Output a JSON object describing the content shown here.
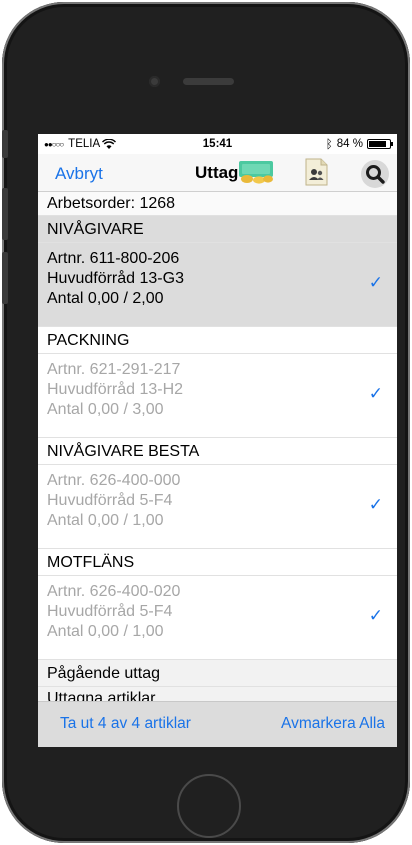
{
  "status": {
    "carrier": "TELIA",
    "time": "15:41",
    "battery": "84 %",
    "battery_level": 0.84
  },
  "navbar": {
    "cancel_label": "Avbryt",
    "title": "Uttag"
  },
  "order": {
    "label": "Arbetsorder: 1268"
  },
  "groups": [
    {
      "name": "NIVÅGIVARE",
      "artnr": "Artnr. 611-800-206",
      "location": "Huvudförråd 13-G3",
      "quantity": "Antal 0,00 / 2,00",
      "checked": "✓"
    },
    {
      "name": "PACKNING",
      "artnr": "Artnr. 621-291-217",
      "location": "Huvudförråd 13-H2",
      "quantity": "Antal 0,00 / 3,00",
      "checked": "✓"
    },
    {
      "name": "NIVÅGIVARE BESTA",
      "artnr": "Artnr. 626-400-000",
      "location": "Huvudförråd 5-F4",
      "quantity": "Antal 0,00 / 1,00",
      "checked": "✓"
    },
    {
      "name": "MOTFLÄNS",
      "artnr": "Artnr. 626-400-020",
      "location": "Huvudförråd 5-F4",
      "quantity": "Antal 0,00 / 1,00",
      "checked": "✓"
    }
  ],
  "sections": {
    "ongoing": "Pågående uttag",
    "taken": "Uttagna artiklar"
  },
  "toolbar": {
    "take_label": "Ta ut 4 av 4 artiklar",
    "unselect_all_label": "Avmarkera Alla"
  },
  "colors": {
    "accent": "#1a73e8",
    "selected_bg": "#dcdcdc",
    "dim_text": "#a7a7a7"
  }
}
